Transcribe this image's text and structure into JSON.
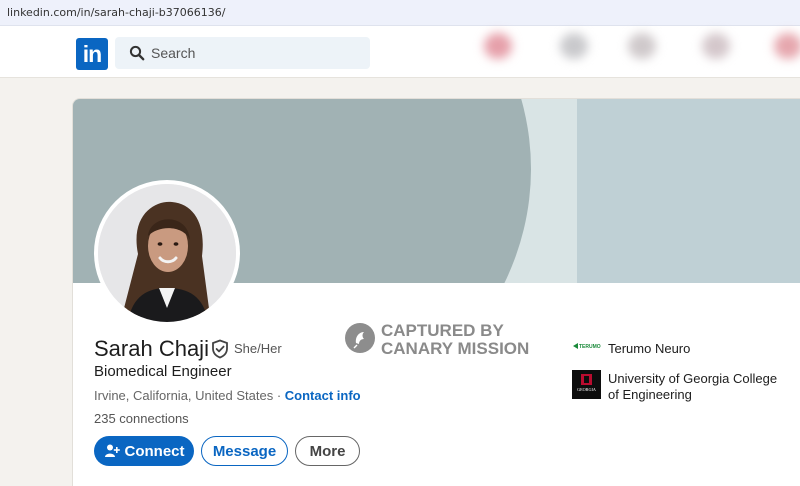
{
  "browser": {
    "url": "linkedin.com/in/sarah-chaji-b37066136/"
  },
  "nav": {
    "logo_text": "in",
    "search_placeholder": "Search"
  },
  "profile": {
    "name": "Sarah Chaji",
    "pronouns": "She/Her",
    "headline": "Biomedical Engineer",
    "location": "Irvine, California, United States",
    "separator": " · ",
    "contact_info": "Contact info",
    "connections": "235 connections"
  },
  "actions": {
    "connect": "Connect",
    "message": "Message",
    "more": "More"
  },
  "watermark": {
    "line1": "CAPTURED BY",
    "line2": "CANARY MISSION"
  },
  "experience": {
    "company": "Terumo Neuro",
    "company_logo_text": "TERUMO",
    "school_line1": "University of Georgia College",
    "school_line2": "of Engineering",
    "school_logo_text": "GEORGIA"
  },
  "colors": {
    "brand": "#0a66c2",
    "banner_primary": "#a1b2b4",
    "banner_secondary": "#c3d2d7"
  }
}
